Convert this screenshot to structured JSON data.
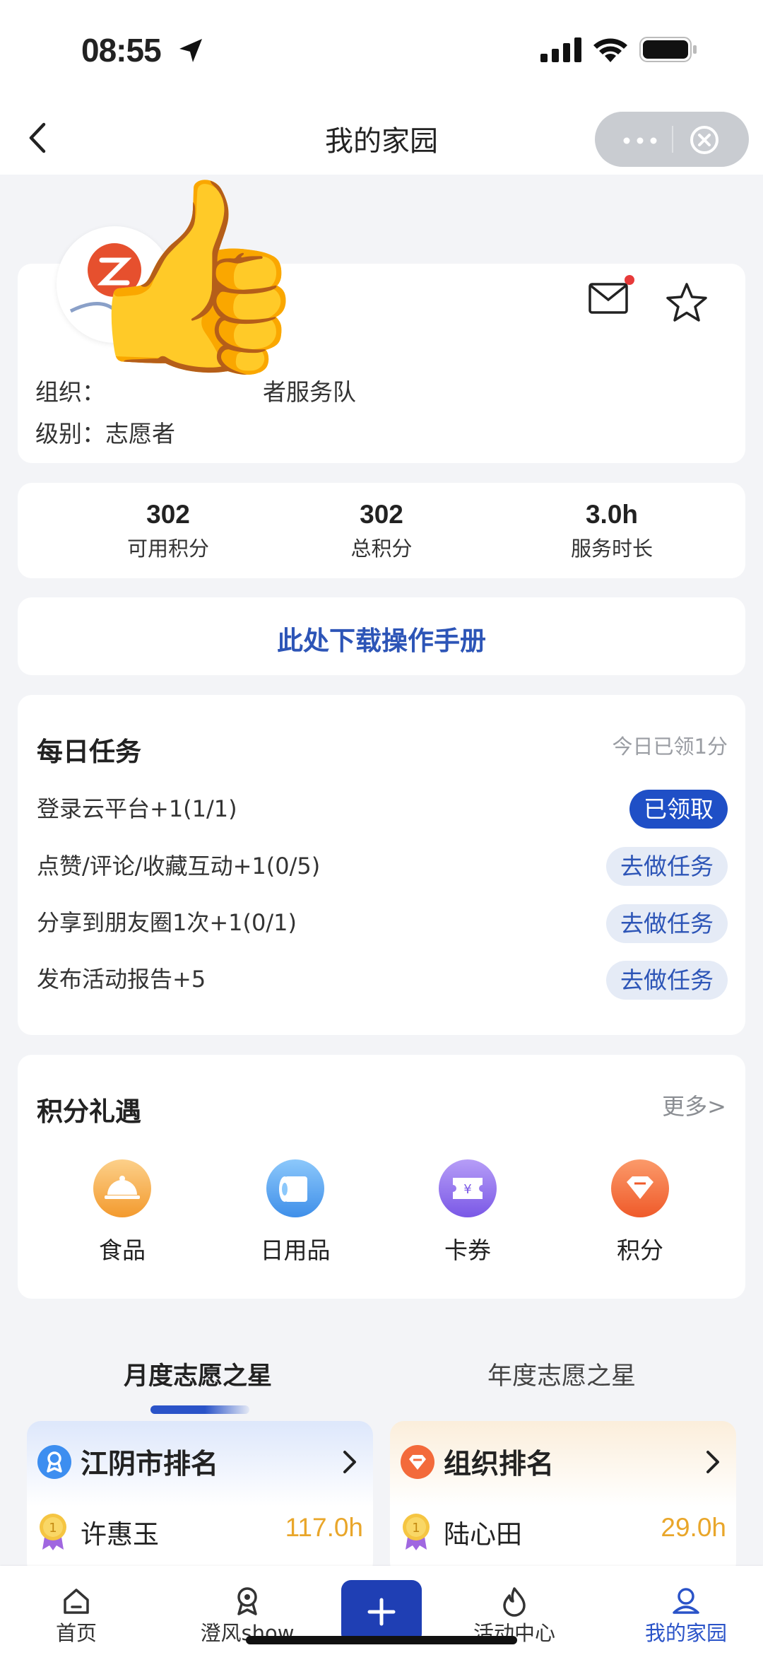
{
  "status_bar": {
    "time": "08:55"
  },
  "nav": {
    "title": "我的家园"
  },
  "profile": {
    "org_label": "组织：",
    "org_visible_suffix": "者服务队",
    "level_label": "级别：",
    "level_value": "志愿者"
  },
  "stats": [
    {
      "value": "302",
      "label": "可用积分"
    },
    {
      "value": "302",
      "label": "总积分"
    },
    {
      "value": "3.0h",
      "label": "服务时长"
    }
  ],
  "manual": {
    "label": "此处下载操作手册"
  },
  "daily_tasks": {
    "title": "每日任务",
    "today_status": "今日已领1分",
    "items": [
      {
        "label": "登录云平台+1(1/1)",
        "button": "已领取",
        "done": true
      },
      {
        "label": "点赞/评论/收藏互动+1(0/5)",
        "button": "去做任务",
        "done": false
      },
      {
        "label": "分享到朋友圈1次+1(0/1)",
        "button": "去做任务",
        "done": false
      },
      {
        "label": "发布活动报告+5",
        "button": "去做任务",
        "done": false
      }
    ]
  },
  "gifts": {
    "title": "积分礼遇",
    "more": "更多>",
    "items": [
      {
        "label": "食品",
        "icon": "food-cloche-icon",
        "color": "#f7b04a"
      },
      {
        "label": "日用品",
        "icon": "tissue-roll-icon",
        "color": "#4a9df0"
      },
      {
        "label": "卡券",
        "icon": "coupon-icon",
        "color": "#8e6cf0"
      },
      {
        "label": "积分",
        "icon": "diamond-points-icon",
        "color": "#f36a3b"
      }
    ]
  },
  "star_tabs": {
    "active": "月度志愿之星",
    "inactive": "年度志愿之星"
  },
  "rankings": [
    {
      "title": "江阴市排名",
      "name": "许惠玉",
      "hours": "117.0h",
      "badge_color": "#3d8ef0"
    },
    {
      "title": "组织排名",
      "name": "陆心田",
      "hours": "29.0h",
      "badge_color": "#f36a3b"
    }
  ],
  "tabbar": [
    {
      "label": "首页",
      "icon": "home-icon"
    },
    {
      "label": "澄风show",
      "icon": "medal-icon"
    },
    {
      "label": "",
      "icon": "plus-icon"
    },
    {
      "label": "活动中心",
      "icon": "flame-icon"
    },
    {
      "label": "我的家园",
      "icon": "user-icon",
      "active": true
    }
  ]
}
